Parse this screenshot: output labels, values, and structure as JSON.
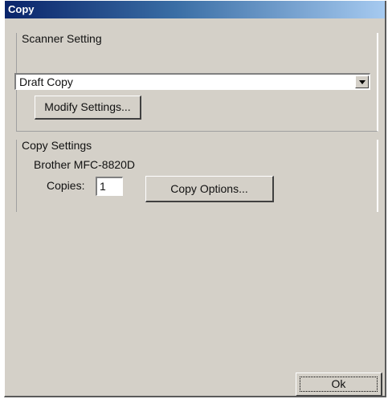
{
  "window": {
    "title": "Copy"
  },
  "scanner_setting": {
    "label": "Scanner Setting",
    "selected_profile": "Draft Copy",
    "modify_button": "Modify Settings..."
  },
  "copy_settings": {
    "label": "Copy Settings",
    "device": "Brother MFC-8820D",
    "copies_label": "Copies:",
    "copies_value": "1",
    "options_button": "Copy Options..."
  },
  "footer": {
    "ok_button": "Ok"
  }
}
